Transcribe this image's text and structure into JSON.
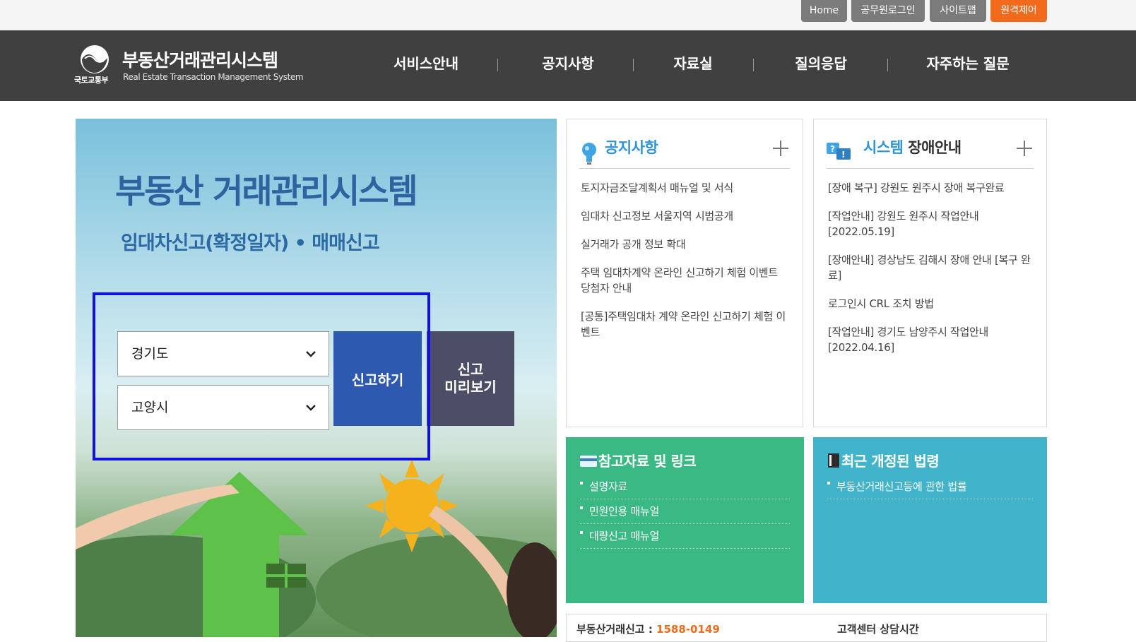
{
  "utility_bar": {
    "home": "Home",
    "staff_login": "공무원로그인",
    "sitemap": "사이트맵",
    "remote_control": "원격제어",
    "colors": {
      "default": "#7b7b7b",
      "remote": "#f26b1d"
    }
  },
  "header": {
    "ministry": "국토교통부",
    "title": "부동산거래관리시스템",
    "subtitle": "Real Estate Transaction Management System",
    "nav": [
      "서비스안내",
      "공지사항",
      "자료실",
      "질의응답",
      "자주하는 질문"
    ]
  },
  "hero": {
    "title": "부동산 거래관리시스템",
    "subtitle": "임대차신고(확정일자) • 매매신고",
    "province_select": "경기도",
    "city_select": "고양시",
    "report_button": "신고하기",
    "preview_button": "신고\n미리보기"
  },
  "notice_panel": {
    "title": "공지사항",
    "items": [
      "토지자금조달계획서 매뉴얼 및 서식",
      "임대차 신고정보 서울지역 시범공개",
      "실거래가 공개 정보 확대",
      "주택 임대차계약 온라인 신고하기 체험 이벤트 당첨자 안내",
      "[공통]주택임대차 계약 온라인 신고하기 체험 이벤트"
    ]
  },
  "outage_panel": {
    "title_colored": "시스템",
    "title_dark": "장애안내",
    "items": [
      "[장애 복구] 강원도 원주시 장애 복구완료",
      "[작업안내] 강원도 원주시 작업안내 [2022.05.19]",
      "[장애안내] 경상남도 김해시 장애 안내 [복구 완료]",
      "로그인시 CRL 조치 방법",
      "[작업안내] 경기도 남양주시 작업안내 [2022.04.16]"
    ]
  },
  "reference_tile": {
    "title": "참고자료 및 링크",
    "color": "#3bb985",
    "items": [
      "설명자료",
      "민원인용 매뉴얼",
      "대량신고 매뉴얼"
    ]
  },
  "law_tile": {
    "title": "최근 개정된 법령",
    "color": "#41b4cc",
    "items": [
      "부동산거래신고등에 관한 법률"
    ]
  },
  "bottom": {
    "left_label": "부동산거래신고 : ",
    "left_phone": "1588-0149",
    "right_label": "고객센터 상담시간"
  }
}
